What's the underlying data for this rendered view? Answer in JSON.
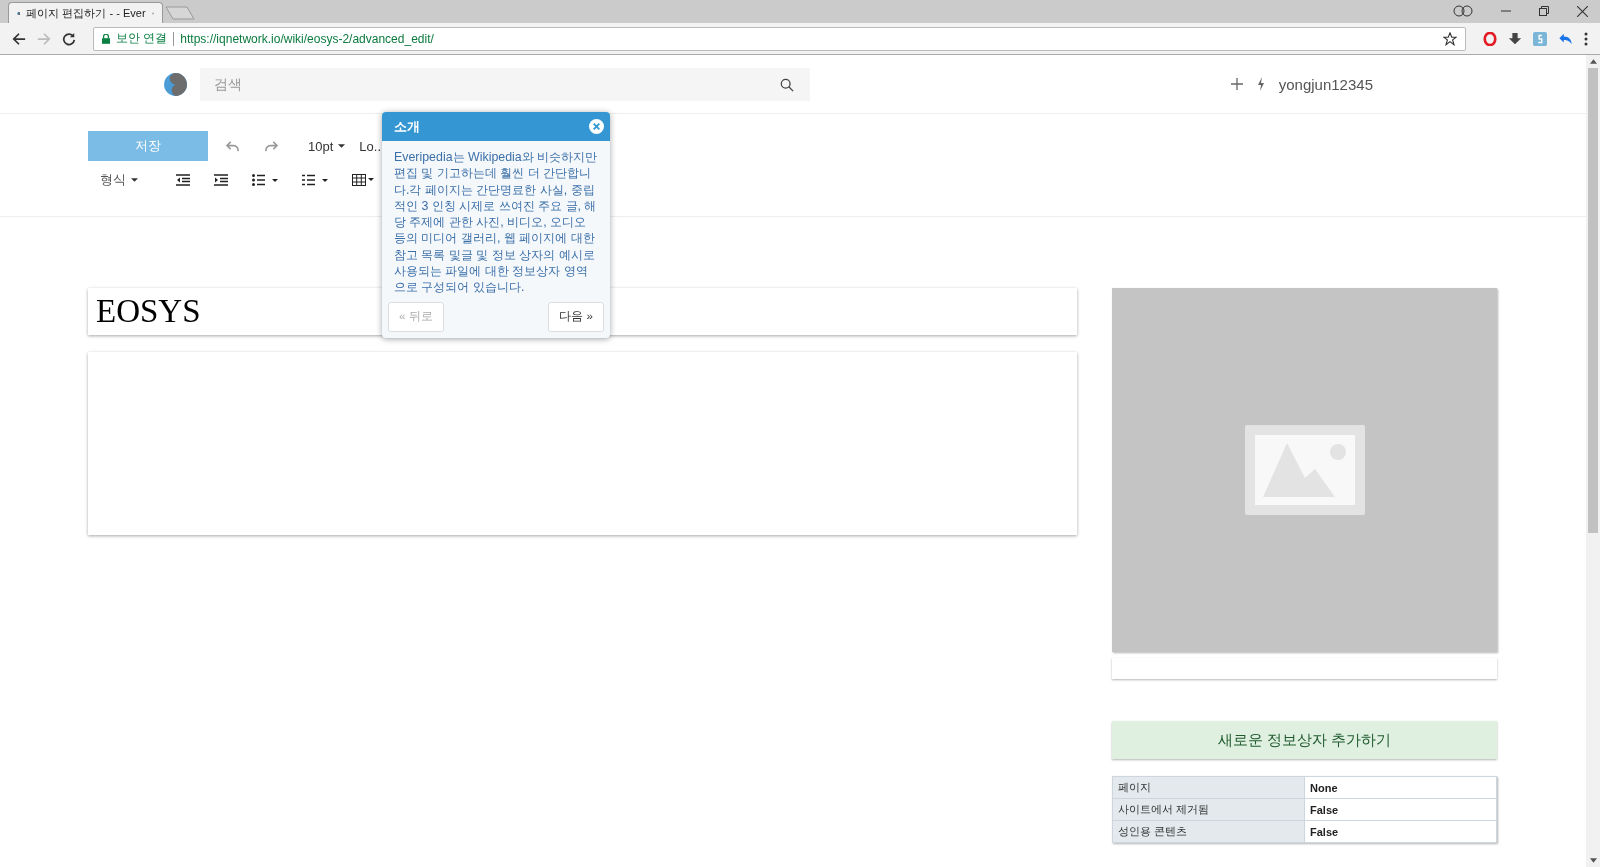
{
  "browser": {
    "tab": {
      "title": "페이지 편집하기 - - Ever"
    },
    "security_label": "보안 연결",
    "url": "https://iqnetwork.io/wiki/eosys-2/advanced_edit/"
  },
  "header": {
    "search": {
      "placeholder": "검색"
    },
    "username": "yongjun12345"
  },
  "toolbar": {
    "save": "저장",
    "font_size": "10pt",
    "font_name": "Lo..",
    "format": "형식"
  },
  "editor": {
    "title": "EOSYS"
  },
  "popup": {
    "title": "소개",
    "body": "Everipedia는 Wikipedia와 비슷하지만 편집 및 기고하는데 훨씬 더 간단합니다.각 페이지는 간단명료한 사실, 중립적인 3 인칭 시제로 쓰여진 주요 글, 해당 주제에 관한 사진, 비디오, 오디오 등의 미디어 갤러리, 웹 페이지에 대한 참고 목록 및글 및 정보 상자의 예시로 사용되는 파일에 대한 정보상자 영역으로 구성되어 있습니다.",
    "buttons": [
      {
        "label": "« 뒤로",
        "disabled": true
      },
      {
        "label": "다음 »",
        "disabled": false
      }
    ]
  },
  "sidebar": {
    "add_infobox": "새로운 정보상자 추가하기",
    "properties": [
      {
        "label": "페이지",
        "value": "None"
      },
      {
        "label": "사이트에서 제거됨",
        "value": "False"
      },
      {
        "label": "성인용 콘텐츠",
        "value": "False"
      }
    ]
  }
}
